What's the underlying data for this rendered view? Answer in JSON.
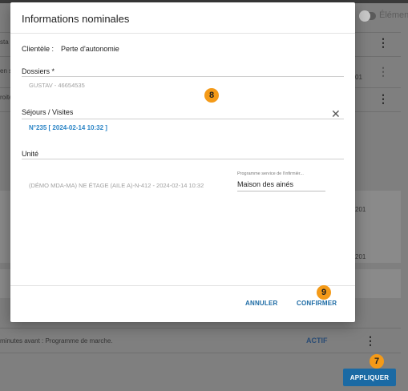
{
  "background": {
    "toggle_label": "Élément",
    "row_texts": [
      "sta",
      "en s",
      "roite"
    ],
    "right_numbers": [
      "01",
      "201",
      "201"
    ],
    "footer_text": "minutes avant : Programme de marche.",
    "status": "ACTIF",
    "apply_button": "APPLIQUER"
  },
  "modal": {
    "title": "Informations nominales",
    "clientele_label": "Clientèle :",
    "clientele_value": "Perte d'autonomie",
    "dossiers_label": "Dossiers *",
    "dossiers_value": "GUSTAV - 46654535",
    "sejours_label": "Séjours / Visites",
    "sejour_value": "N°235 [ 2024-02-14 10:32 ]",
    "unite_label": "Unité",
    "unite_value": "(DÉMO MDA-MA) NE ÉTAGE (AILE A)-N-412 - 2024-02-14 10:32",
    "programme_label": "Programme service de l'infirmièr...",
    "programme_value": "Maison des ainés",
    "cancel_button": "ANNULER",
    "confirm_button": "CONFIRMER"
  },
  "badges": {
    "modal_badge": "8",
    "confirm_badge": "9",
    "apply_badge": "7"
  },
  "colors": {
    "accent": "#1b6aa4",
    "badge": "#f49a18",
    "chip": "#2a84c6"
  }
}
